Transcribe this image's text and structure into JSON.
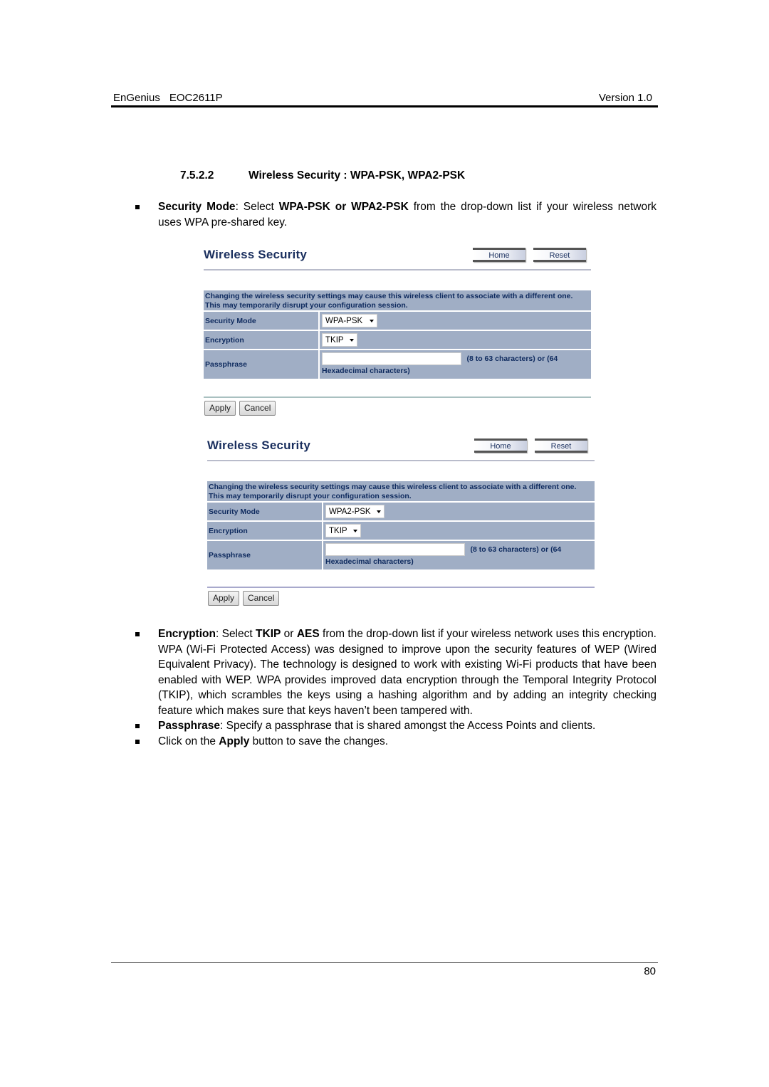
{
  "header": {
    "brand": "EnGenius",
    "model": "EOC2611P",
    "version": "Version 1.0"
  },
  "section": {
    "number": "7.5.2.2",
    "title": "Wireless Security : WPA-PSK, WPA2-PSK"
  },
  "intro_bullet": {
    "term": "Security Mode",
    "sep": ": Select ",
    "options_bold": "WPA-PSK or WPA2-PSK",
    "rest": " from the drop-down list if your wireless network uses WPA pre-shared key."
  },
  "panels": [
    {
      "title": "Wireless Security",
      "home_label": "Home",
      "reset_label": "Reset",
      "note_line1": "Changing the wireless security settings may cause this wireless client to associate with a different one.",
      "note_line2": "This may temporarily disrupt your configuration session.",
      "security_mode_label": "Security Mode",
      "security_mode_value": "WPA-PSK",
      "encryption_label": "Encryption",
      "encryption_value": "TKIP",
      "passphrase_label": "Passphrase",
      "passphrase_value": "",
      "passphrase_hint1": "(8 to 63 characters) or (64",
      "passphrase_hint2": "Hexadecimal characters)",
      "apply_label": "Apply",
      "cancel_label": "Cancel"
    },
    {
      "title": "Wireless Security",
      "home_label": "Home",
      "reset_label": "Reset",
      "note_line1": "Changing the wireless security settings may cause this wireless client to associate with a different one.",
      "note_line2": "This may temporarily disrupt your configuration session.",
      "security_mode_label": "Security Mode",
      "security_mode_value": "WPA2-PSK",
      "encryption_label": "Encryption",
      "encryption_value": "TKIP",
      "passphrase_label": "Passphrase",
      "passphrase_value": "",
      "passphrase_hint1": "(8 to 63 characters) or (64",
      "passphrase_hint2": "Hexadecimal characters)",
      "apply_label": "Apply",
      "cancel_label": "Cancel"
    }
  ],
  "bullets": {
    "encryption": {
      "term": "Encryption",
      "p1": ": Select ",
      "tkip": "TKIP",
      "p2": " or ",
      "aes": "AES",
      "p3": " from the drop-down list if your wireless network uses this encryption. WPA (Wi-Fi Protected Access) was designed to improve upon the security features of WEP (Wired Equivalent Privacy). The technology is designed to work with existing Wi-Fi products that have been enabled with WEP. WPA provides improved data encryption through the Temporal Integrity Protocol (TKIP), which scrambles the keys using a hashing algorithm and by adding an integrity checking feature which makes sure that keys haven’t been tampered with."
    },
    "passphrase": {
      "term": "Passphrase",
      "rest": ": Specify a passphrase that is shared amongst the Access Points and clients."
    },
    "apply": {
      "p1": "Click on the ",
      "term": "Apply",
      "p2": " button to save the changes."
    }
  },
  "footer": {
    "page_number": "80"
  },
  "colors": {
    "panel_title": "#1a2f5e",
    "table_bg": "#a0aec5",
    "table_text": "#0e2a5e"
  }
}
